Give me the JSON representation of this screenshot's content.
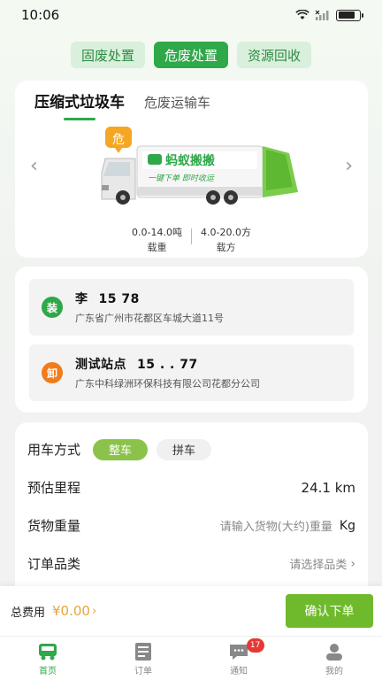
{
  "status_bar": {
    "time": "10:06"
  },
  "top_tabs": [
    {
      "label": "固废处置",
      "active": false
    },
    {
      "label": "危废处置",
      "active": true
    },
    {
      "label": "资源回收",
      "active": false
    }
  ],
  "truck_tabs": [
    {
      "label": "压缩式垃圾车",
      "active": true
    },
    {
      "label": "危废运输车",
      "active": false
    }
  ],
  "truck": {
    "badge": "危",
    "brand": "蚂蚁搬搬",
    "slogan": "一键下单 即时收运",
    "specs": [
      {
        "value": "0.0-14.0吨",
        "label": "载重"
      },
      {
        "value": "4.0-20.0方",
        "label": "载方"
      }
    ]
  },
  "route": {
    "load": {
      "badge": "装",
      "name": "李",
      "phone": "15           78",
      "address": "广东省广州市花都区车城大道11号"
    },
    "unload": {
      "badge": "卸",
      "name": "测试站点",
      "phone": "15   .   .   77",
      "address": "广东中科绿洲环保科技有限公司花都分公司"
    }
  },
  "form": {
    "mode_label": "用车方式",
    "modes": [
      {
        "label": "整车",
        "active": true
      },
      {
        "label": "拼车",
        "active": false
      }
    ],
    "distance_label": "预估里程",
    "distance_value": "24.1 km",
    "weight_label": "货物重量",
    "weight_placeholder": "请输入货物(大约)重量",
    "weight_unit": "Kg",
    "category_label": "订单品类",
    "category_placeholder": "请选择品类"
  },
  "footer": {
    "total_label": "总费用",
    "total_value": "¥0.00",
    "confirm_label": "确认下单"
  },
  "tabbar": [
    {
      "label": "首页",
      "icon": "truck-icon",
      "active": true
    },
    {
      "label": "订单",
      "icon": "order-icon",
      "active": false
    },
    {
      "label": "通知",
      "icon": "message-icon",
      "active": false,
      "badge": "17"
    },
    {
      "label": "我的",
      "icon": "user-icon",
      "active": false
    }
  ],
  "colors": {
    "primary": "#2fa84a",
    "accent_light": "#8bc34a",
    "price": "#e8a33a",
    "unload": "#f07c1c"
  }
}
